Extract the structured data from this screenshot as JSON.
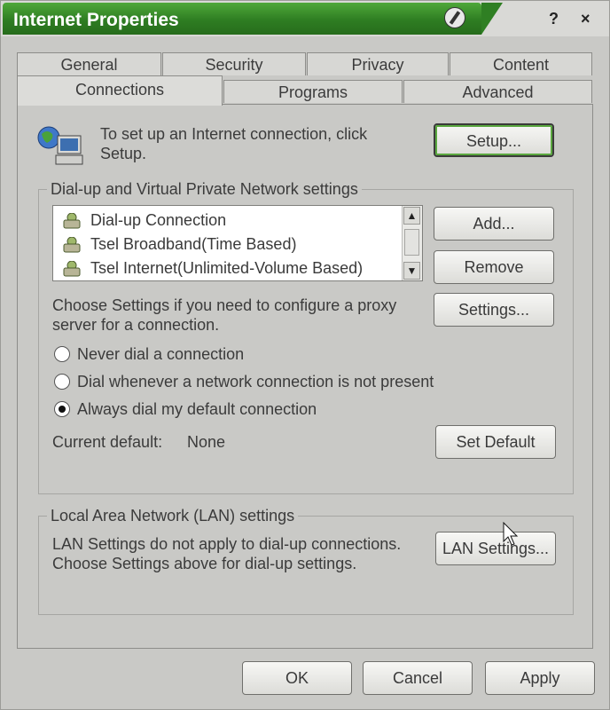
{
  "window": {
    "title": "Internet Properties",
    "help_label": "?",
    "close_label": "×"
  },
  "tabs": {
    "row1": [
      "General",
      "Security",
      "Privacy",
      "Content"
    ],
    "row2": [
      "Connections",
      "Programs",
      "Advanced"
    ]
  },
  "setup": {
    "text_line1": "To set up an Internet connection, click",
    "text_line2": "Setup.",
    "button": "Setup..."
  },
  "dialup": {
    "group_label": "Dial-up and Virtual Private Network settings",
    "items": [
      "Dial-up Connection",
      "Tsel Broadband(Time Based)",
      "Tsel Internet(Unlimited-Volume Based)"
    ],
    "add_button": "Add...",
    "remove_button": "Remove",
    "settings_button": "Settings...",
    "proxy_text_line1": "Choose Settings if you need to configure a proxy",
    "proxy_text_line2": "server for a connection.",
    "options": [
      "Never dial a connection",
      "Dial whenever a network connection is not present",
      "Always dial my default connection"
    ],
    "selected_option": 2,
    "current_default_label": "Current default:",
    "current_default_value": "None",
    "set_default_button": "Set Default"
  },
  "lan": {
    "group_label": "Local Area Network (LAN) settings",
    "text_line1": "LAN Settings do not apply to dial-up connections.",
    "text_line2": "Choose Settings above for dial-up settings.",
    "button": "LAN Settings..."
  },
  "footer": {
    "ok": "OK",
    "cancel": "Cancel",
    "apply": "Apply"
  },
  "colors": {
    "title_green": "#2e7d22",
    "dialog_gray": "#c9c9c6",
    "default_ring": "#5aa83f"
  }
}
